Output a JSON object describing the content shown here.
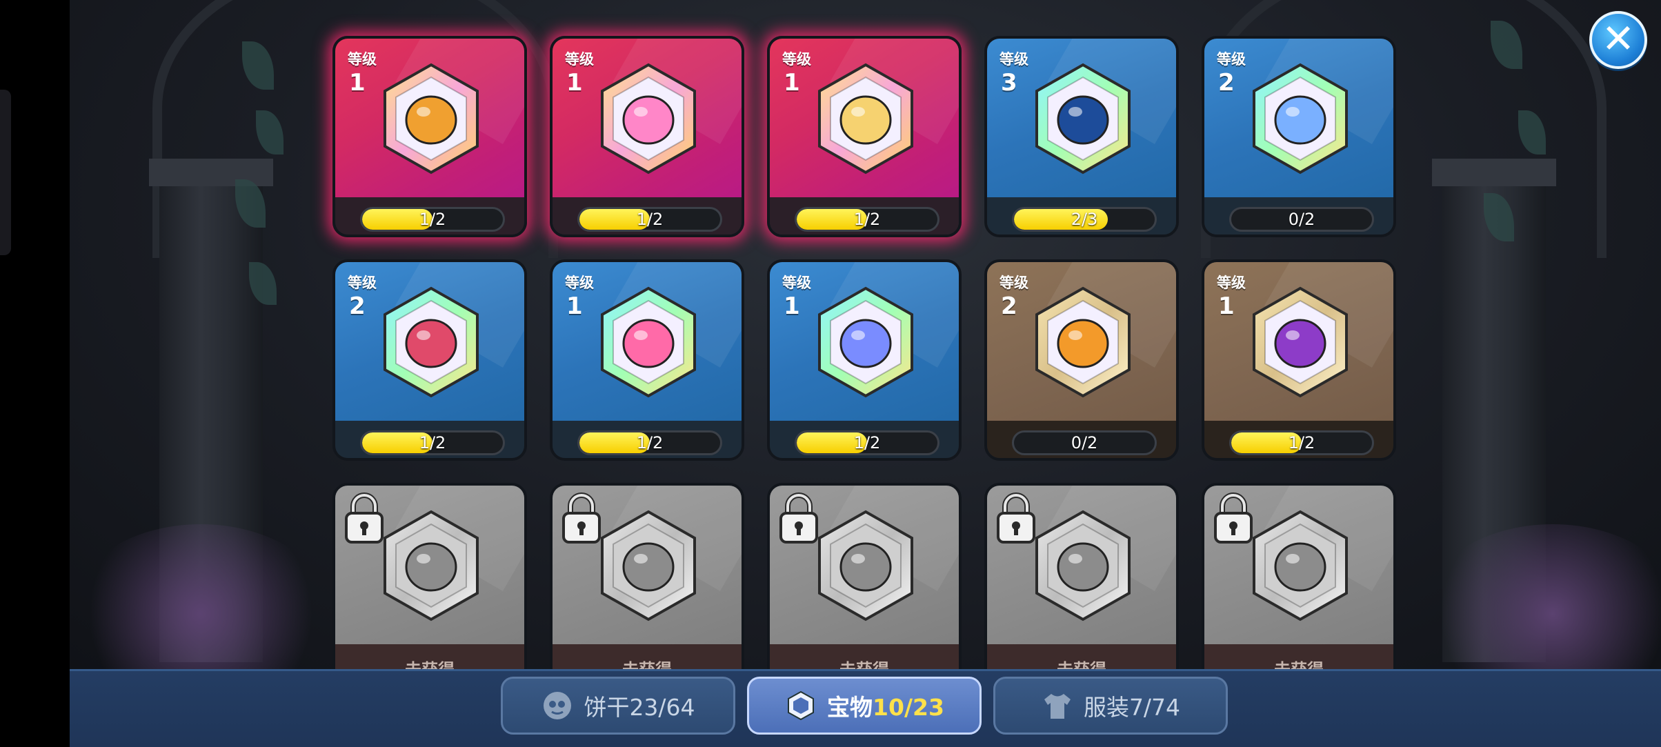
{
  "close_button": {
    "label": "✕"
  },
  "level_label": "等级",
  "locked_text": "未获得",
  "cards": [
    {
      "state": "red",
      "level": "1",
      "progress_text": "1/2",
      "progress": 0.5,
      "icon": "flame-crown-treasure-icon",
      "accent": "#f0a030"
    },
    {
      "state": "red",
      "level": "1",
      "progress_text": "1/2",
      "progress": 0.5,
      "icon": "cat-candy-treasure-icon",
      "accent": "#ff86c8"
    },
    {
      "state": "red",
      "level": "1",
      "progress_text": "1/2",
      "progress": 0.5,
      "icon": "golden-wreath-treasure-icon",
      "accent": "#f6d270"
    },
    {
      "state": "blue",
      "level": "3",
      "progress_text": "2/3",
      "progress": 0.667,
      "icon": "spiked-shell-treasure-icon",
      "accent": "#1d4c9a"
    },
    {
      "state": "blue",
      "level": "2",
      "progress_text": "0/2",
      "progress": 0.0,
      "icon": "bone-scythe-treasure-icon",
      "accent": "#7ab0ff"
    },
    {
      "state": "blue",
      "level": "2",
      "progress_text": "1/2",
      "progress": 0.5,
      "icon": "burning-scroll-treasure-icon",
      "accent": "#e04a6a"
    },
    {
      "state": "blue",
      "level": "1",
      "progress_text": "1/2",
      "progress": 0.5,
      "icon": "pink-bow-treasure-icon",
      "accent": "#ff6aa8"
    },
    {
      "state": "blue",
      "level": "1",
      "progress_text": "1/2",
      "progress": 0.5,
      "icon": "swirl-ghost-treasure-icon",
      "accent": "#7a8cff"
    },
    {
      "state": "brown",
      "level": "2",
      "progress_text": "0/2",
      "progress": 0.0,
      "icon": "coin-pouch-treasure-icon",
      "accent": "#f39a2a"
    },
    {
      "state": "brown",
      "level": "1",
      "progress_text": "1/2",
      "progress": 0.5,
      "icon": "purple-feather-treasure-icon",
      "accent": "#8d3cc8"
    },
    {
      "state": "gray",
      "icon": "locked-bomb-treasure-icon"
    },
    {
      "state": "gray",
      "icon": "locked-swan-treasure-icon"
    },
    {
      "state": "gray",
      "icon": "locked-cloud-treasure-icon"
    },
    {
      "state": "gray",
      "icon": "locked-mummy-treasure-icon"
    },
    {
      "state": "gray",
      "icon": "locked-stone-treasure-icon"
    }
  ],
  "tabs": [
    {
      "icon": "cookie-icon",
      "label": "饼干",
      "count": "23/64",
      "active": false
    },
    {
      "icon": "treasure-hexagon-icon",
      "label": "宝物",
      "count": "10/23",
      "active": true
    },
    {
      "icon": "costume-shirt-icon",
      "label": "服装",
      "count": "7/74",
      "active": false
    }
  ],
  "colors": {
    "red_card": "#d32a63",
    "blue_card": "#2c74b9",
    "brown_card": "#7e6550",
    "locked_card": "#8a8a8a",
    "progress_fill": "#f7cf00",
    "active_tab": "#4c6fb8"
  }
}
